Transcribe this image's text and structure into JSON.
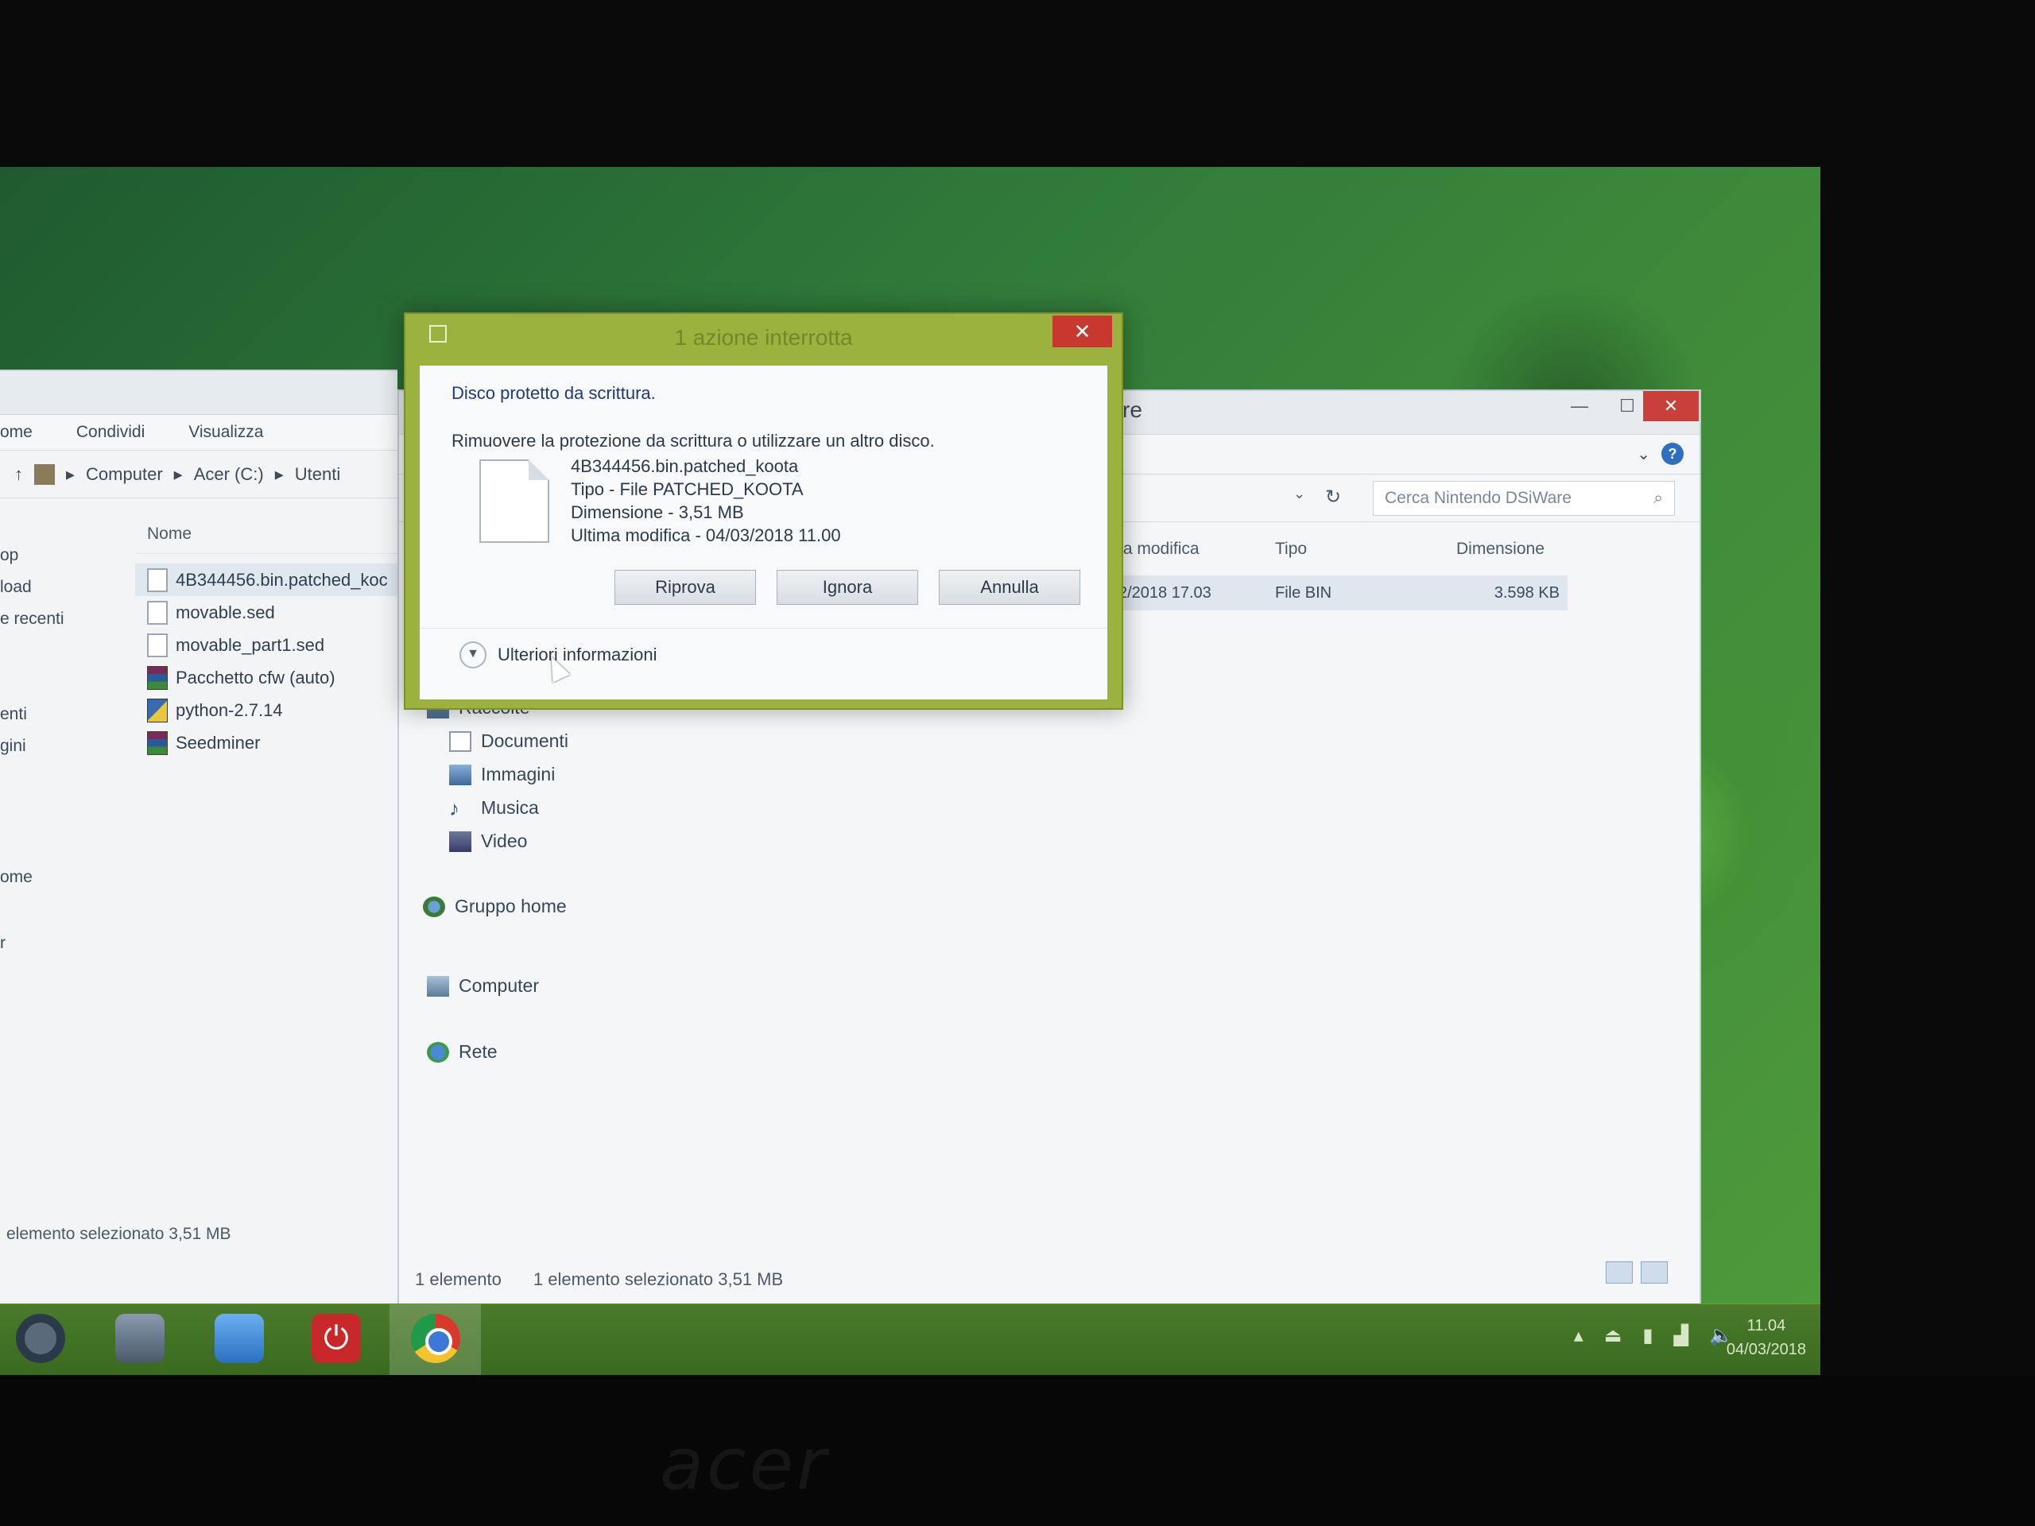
{
  "left_window": {
    "tabs": [
      "ome",
      "Condividi",
      "Visualizza"
    ],
    "breadcrumb": [
      "Computer",
      "Acer (C:)",
      "Utenti"
    ],
    "nav_items": [
      "op",
      "load",
      "e recenti",
      "enti",
      "gini",
      "ome",
      "r"
    ],
    "column_header": "Nome",
    "files": [
      {
        "name": "4B344456.bin.patched_koc",
        "icon": "file-icon"
      },
      {
        "name": "movable.sed",
        "icon": "file-icon"
      },
      {
        "name": "movable_part1.sed",
        "icon": "file-icon"
      },
      {
        "name": "Pacchetto cfw (auto)",
        "icon": "archive-icon"
      },
      {
        "name": "python-2.7.14",
        "icon": "installer-icon"
      },
      {
        "name": "Seedminer",
        "icon": "archive-icon"
      }
    ],
    "status": "elemento selezionato  3,51 MB"
  },
  "main_window": {
    "title_fragment": "re",
    "search_placeholder": "Cerca Nintendo DSiWare",
    "columns": {
      "modified": "ta modifica",
      "type": "Tipo",
      "size": "Dimensione"
    },
    "row": {
      "modified": "2/2018 17.03",
      "type": "File BIN",
      "size": "3.598 KB"
    },
    "nav": {
      "libraries": "Raccolte",
      "documents": "Documenti",
      "images": "Immagini",
      "music": "Musica",
      "video": "Video",
      "homegroup": "Gruppo home",
      "computer": "Computer",
      "network": "Rete"
    },
    "status_count": "1 elemento",
    "status_selected": "1 elemento selezionato  3,51 MB"
  },
  "dialog": {
    "title": "1 azione interrotta",
    "heading": "Disco protetto da scrittura.",
    "message": "Rimuovere la protezione da scrittura o utilizzare un altro disco.",
    "file_name": "4B344456.bin.patched_koota",
    "file_type": "Tipo - File PATCHED_KOOTA",
    "file_size": "Dimensione - 3,51 MB",
    "file_modified": "Ultima modifica - 04/03/2018 11.00",
    "buttons": {
      "retry": "Riprova",
      "ignore": "Ignora",
      "cancel": "Annulla"
    },
    "more_info": "Ulteriori informazioni"
  },
  "taskbar": {
    "clock_time": "11.04",
    "clock_date": "04/03/2018"
  },
  "brand": "acer",
  "colors": {
    "dialog_frame": "#9bb33e",
    "close_button": "#c8382f",
    "heading_text": "#1e3a78",
    "desktop": "#2f7a3a"
  }
}
